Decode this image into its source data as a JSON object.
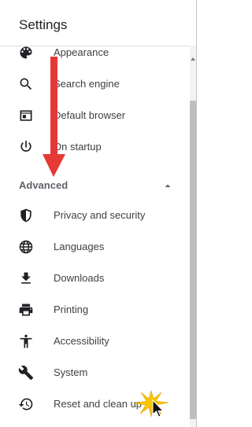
{
  "header": {
    "title": "Settings"
  },
  "menu_items": [
    {
      "label": "Appearance",
      "icon": "palette-icon"
    },
    {
      "label": "Search engine",
      "icon": "search-icon"
    },
    {
      "label": "Default browser",
      "icon": "browser-window-icon"
    },
    {
      "label": "On startup",
      "icon": "power-icon"
    }
  ],
  "advanced": {
    "label": "Advanced",
    "expanded": true,
    "items": [
      {
        "label": "Privacy and security",
        "icon": "shield-icon"
      },
      {
        "label": "Languages",
        "icon": "globe-icon"
      },
      {
        "label": "Downloads",
        "icon": "download-icon"
      },
      {
        "label": "Printing",
        "icon": "printer-icon"
      },
      {
        "label": "Accessibility",
        "icon": "accessibility-icon"
      },
      {
        "label": "System",
        "icon": "wrench-icon"
      },
      {
        "label": "Reset and clean up",
        "icon": "reset-history-icon"
      }
    ]
  },
  "colors": {
    "icon": "#202124",
    "annotation_arrow": "#e53935",
    "click_burst": "#f7c600"
  }
}
